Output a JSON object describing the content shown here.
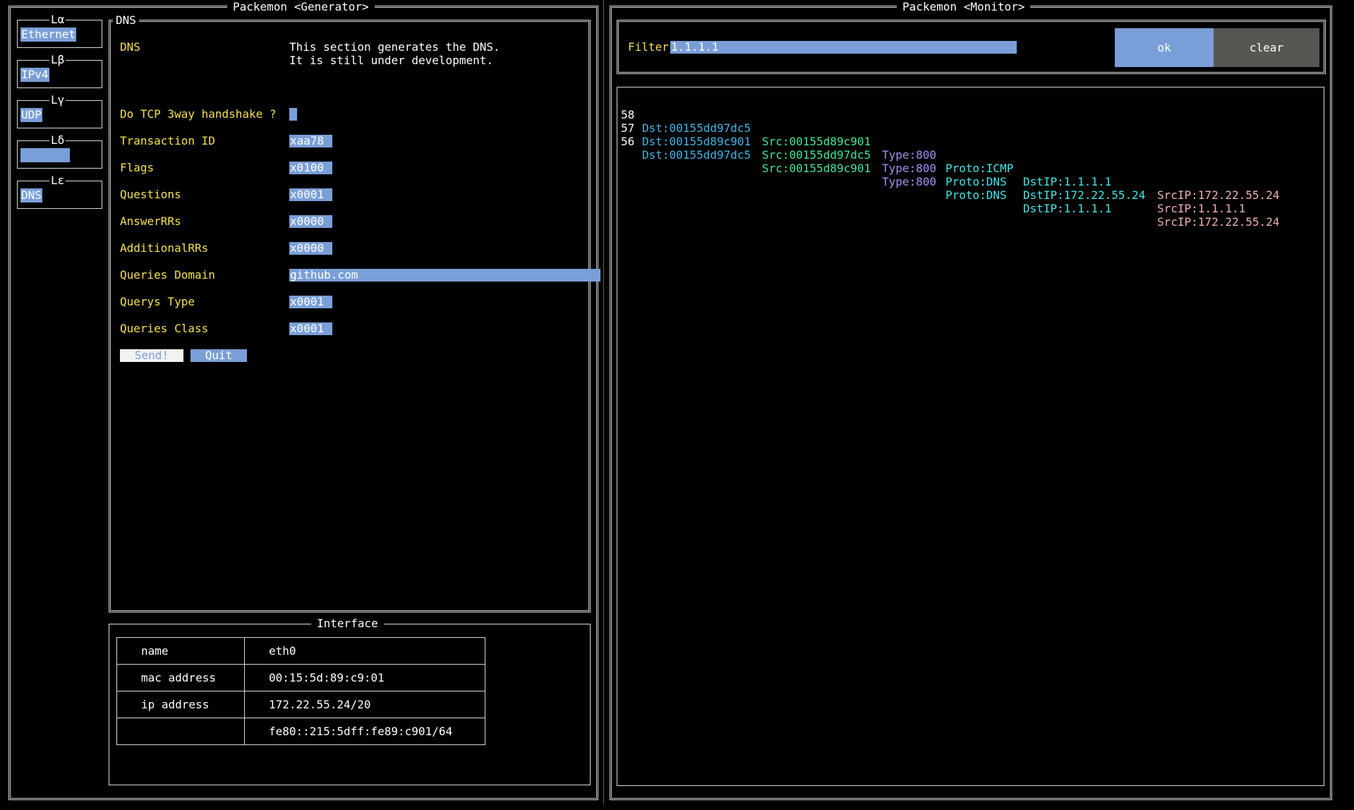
{
  "generator": {
    "title": "Packemon <Generator>",
    "layers": [
      {
        "name": "Lα",
        "value": "Ethernet"
      },
      {
        "name": "Lβ",
        "value": "IPv4"
      },
      {
        "name": "Lγ",
        "value": "UDP"
      },
      {
        "name": "Lδ",
        "value": ""
      },
      {
        "name": "Lε",
        "value": "DNS"
      }
    ],
    "dns": {
      "panel_title": "DNS",
      "header_label": "DNS",
      "description_line1": "This section generates the DNS.",
      "description_line2": "It is still under development.",
      "tcp_handshake_label": "Do TCP 3way handshake ?",
      "tcp_handshake_value": " ",
      "fields": [
        {
          "label": "Transaction ID",
          "value": "xaa78"
        },
        {
          "label": "Flags",
          "value": "x0100"
        },
        {
          "label": "Questions",
          "value": "x0001"
        },
        {
          "label": "AnswerRRs",
          "value": "x0000"
        },
        {
          "label": "AdditionalRRs",
          "value": "x0000"
        },
        {
          "label": "Queries Domain",
          "value": "github.com"
        },
        {
          "label": "Querys Type",
          "value": "x0001"
        },
        {
          "label": "Queries Class",
          "value": "x0001"
        }
      ],
      "send_label": "Send!",
      "quit_label": "Quit"
    },
    "interface": {
      "title": "Interface",
      "rows": [
        {
          "key": "name",
          "value": "eth0"
        },
        {
          "key": "mac address",
          "value": "00:15:5d:89:c9:01"
        },
        {
          "key": "ip address",
          "value": "172.22.55.24/20"
        },
        {
          "key": "",
          "value": "fe80::215:5dff:fe89:c901/64"
        }
      ]
    }
  },
  "monitor": {
    "title": "Packemon <Monitor>",
    "filter_label": "Filter",
    "filter_value": "1.1.1.1",
    "ok_label": "ok",
    "clear_label": "clear",
    "packets": [
      {
        "no": "58",
        "dst": "Dst:00155dd97dc5",
        "src": "Src:00155d89c901",
        "type": "Type:800",
        "proto": "Proto:ICMP",
        "dstip": "DstIP:1.1.1.1",
        "srcip": "SrcIP:172.22.55.24"
      },
      {
        "no": "57",
        "dst": "Dst:00155d89c901",
        "src": "Src:00155dd97dc5",
        "type": "Type:800",
        "proto": "Proto:DNS",
        "dstip": "DstIP:172.22.55.24",
        "srcip": "SrcIP:1.1.1.1"
      },
      {
        "no": "56",
        "dst": "Dst:00155dd97dc5",
        "src": "Src:00155d89c901",
        "type": "Type:800",
        "proto": "Proto:DNS",
        "dstip": "DstIP:1.1.1.1",
        "srcip": "SrcIP:172.22.55.24"
      }
    ],
    "colors": {
      "no": "#ffffff",
      "dst": "#3fb6e8",
      "src": "#3fe89a",
      "type": "#a98df0",
      "proto": "#3ee8e8",
      "dstip": "#3ee8e8",
      "srcip": "#f0b3b0"
    }
  }
}
